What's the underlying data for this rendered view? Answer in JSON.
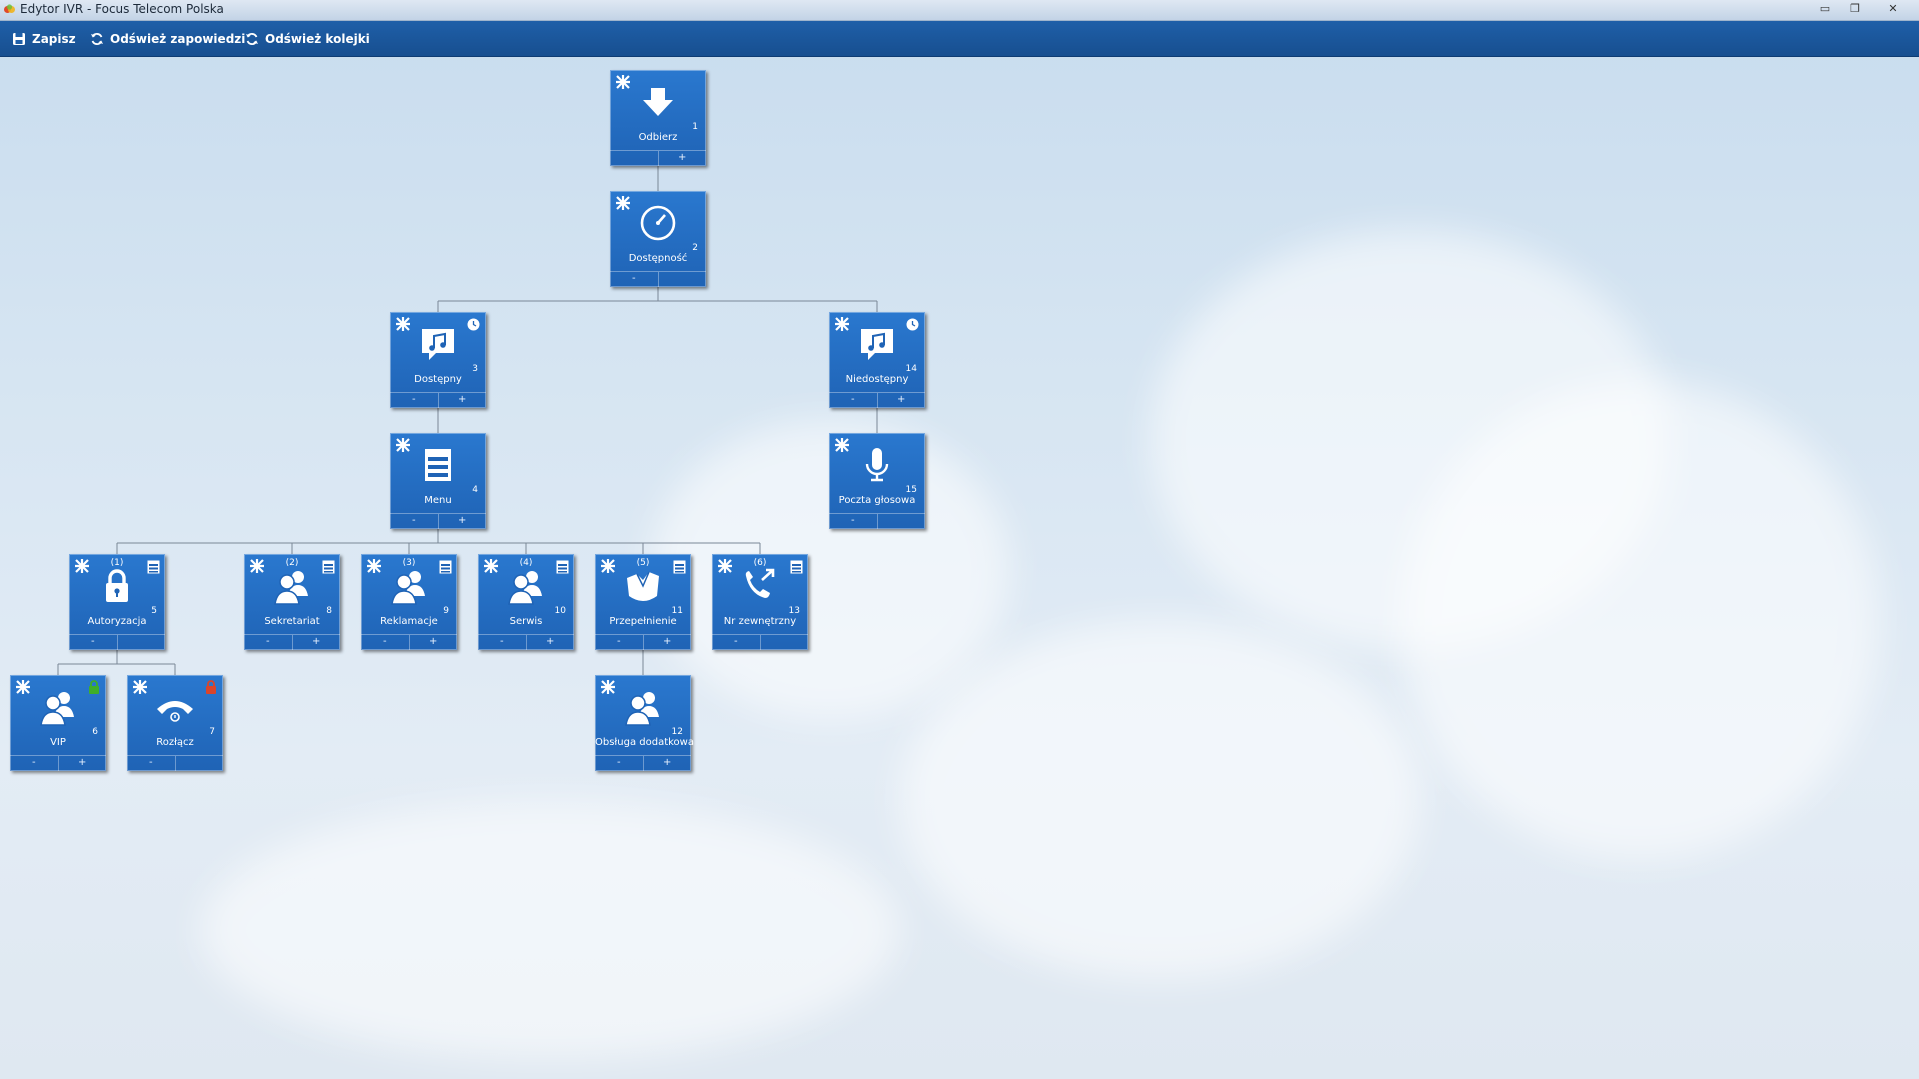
{
  "window": {
    "title": "Edytor IVR - Focus Telecom Polska",
    "controls": {
      "minimize": "▭",
      "maximize": "❐",
      "close": "✕"
    }
  },
  "toolbar": {
    "save_label": "Zapisz",
    "refresh_announcements_label": "Odśwież zapowiedzi",
    "refresh_queues_label": "Odśwież kolejki"
  },
  "colors": {
    "node_blue": "#2a78cf",
    "toolbar_blue": "#1f5fa8",
    "lock_green": "#3fae2a",
    "lock_red": "#d9452b"
  },
  "nodes": [
    {
      "id": "odbierz",
      "label": "Odbierz",
      "number": "1",
      "icon": "arrow-down-icon",
      "footer_left": "",
      "footer_right": "+"
    },
    {
      "id": "dostepnosc",
      "label": "Dostępność",
      "number": "2",
      "icon": "clock-icon",
      "footer_left": "-",
      "footer_right": ""
    },
    {
      "id": "dostepny",
      "label": "Dostępny",
      "number": "3",
      "icon": "music-note-icon",
      "footer_left": "-",
      "footer_right": "+",
      "badge": "clock-badge-icon"
    },
    {
      "id": "niedostepny",
      "label": "Niedostępny",
      "number": "14",
      "icon": "music-note-icon",
      "footer_left": "-",
      "footer_right": "+",
      "badge": "clock-badge-icon"
    },
    {
      "id": "menu",
      "label": "Menu",
      "number": "4",
      "icon": "menu-icon",
      "footer_left": "-",
      "footer_right": "+"
    },
    {
      "id": "poczta",
      "label": "Poczta głosowa",
      "number": "15",
      "icon": "microphone-icon",
      "footer_left": "-",
      "footer_right": ""
    },
    {
      "id": "autoryzacja",
      "label": "Autoryzacja",
      "number": "5",
      "icon": "lock-icon",
      "option": "(1)",
      "footer_left": "-",
      "footer_right": "",
      "badge": "menu-badge-icon"
    },
    {
      "id": "sekretariat",
      "label": "Sekretariat",
      "number": "8",
      "icon": "users-icon",
      "option": "(2)",
      "footer_left": "-",
      "footer_right": "+",
      "badge": "menu-badge-icon"
    },
    {
      "id": "reklamacje",
      "label": "Reklamacje",
      "number": "9",
      "icon": "users-icon",
      "option": "(3)",
      "footer_left": "-",
      "footer_right": "+",
      "badge": "menu-badge-icon"
    },
    {
      "id": "serwis",
      "label": "Serwis",
      "number": "10",
      "icon": "users-icon",
      "option": "(4)",
      "footer_left": "-",
      "footer_right": "+",
      "badge": "menu-badge-icon"
    },
    {
      "id": "przepelnienie",
      "label": "Przepełnienie",
      "number": "11",
      "icon": "overflow-icon",
      "option": "(5)",
      "footer_left": "-",
      "footer_right": "+",
      "badge": "menu-badge-icon"
    },
    {
      "id": "nrzew",
      "label": "Nr zewnętrzny",
      "number": "13",
      "icon": "phone-transfer-icon",
      "option": "(6)",
      "footer_left": "-",
      "footer_right": "",
      "badge": "menu-badge-icon"
    },
    {
      "id": "vip",
      "label": "VIP",
      "number": "6",
      "icon": "users-icon",
      "footer_left": "-",
      "footer_right": "+",
      "badge": "lock-green-icon"
    },
    {
      "id": "rozlacz",
      "label": "Rozłącz",
      "number": "7",
      "icon": "hangup-icon",
      "footer_left": "-",
      "footer_right": "",
      "badge": "lock-red-icon"
    },
    {
      "id": "obsluga",
      "label": "Obsługa dodatkowa",
      "number": "12",
      "icon": "users-icon",
      "footer_left": "-",
      "footer_right": "+"
    }
  ]
}
